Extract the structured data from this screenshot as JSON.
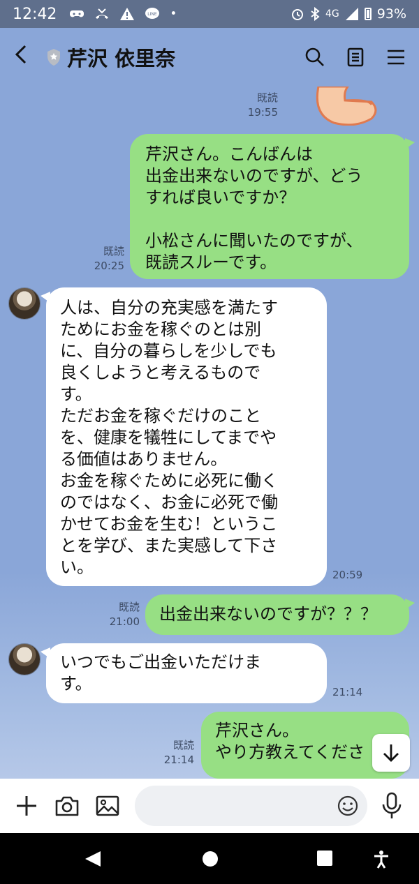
{
  "status_bar": {
    "time": "12:42",
    "network": "4G",
    "battery": "93%"
  },
  "header": {
    "title": "芹沢 依里奈"
  },
  "messages": [
    {
      "side": "sent",
      "text": "芹沢さん。こんばんは\n出金出来ないのですが、どう\nすれば良いですか？\n\n小松さんに聞いたのですが、\n既読スルーです。",
      "read": "既読",
      "time": "20:25"
    },
    {
      "side": "recv",
      "text": "人は、自分の充実感を満たす\nためにお金を稼ぐのとは別\nに、自分の暮らしを少しでも\n良くしようと考えるもので\nす。\nただお金を稼ぐだけのこと\nを、健康を犠牲にしてまでや\nる価値はありません。\nお金を稼ぐために必死に働く\nのではなく、お金に必死で働\nかせてお金を生む！というこ\nとを学び、また実感して下さ\nい。",
      "time": "20:59"
    },
    {
      "side": "sent",
      "text": "出金出来ないのですが？？？",
      "read": "既読",
      "time": "21:00"
    },
    {
      "side": "recv",
      "text": "いつでもご出金いただけま\nす。",
      "time": "21:14"
    },
    {
      "side": "sent",
      "text": "芹沢さん。\nやり方教えてくださ",
      "read": "既読",
      "time": "21:14"
    }
  ],
  "top_meta": {
    "read": "既読",
    "time": "19:55"
  },
  "colors": {
    "chat_bg": "#8aa6d8",
    "sent_bubble": "#97df84",
    "recv_bubble": "#ffffff",
    "status_bar": "#5f6f8c"
  }
}
